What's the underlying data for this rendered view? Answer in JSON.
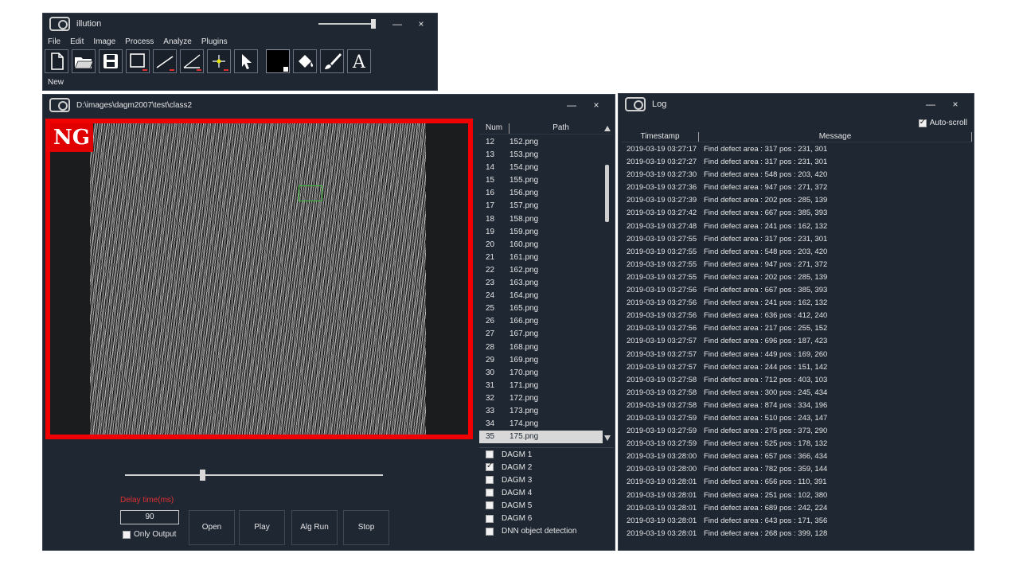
{
  "main_window": {
    "title": "illution",
    "menu": [
      "File",
      "Edit",
      "Image",
      "Process",
      "Analyze",
      "Plugins"
    ],
    "tools": [
      "new-file-icon",
      "open-folder-icon",
      "save-icon",
      "rectangle-tool-icon",
      "line-tool-icon",
      "angle-tool-icon",
      "point-tool-icon",
      "pointer-icon",
      "color-swatch-icon",
      "fill-bucket-icon",
      "brush-icon",
      "text-tool-icon"
    ],
    "status": "New",
    "minimize": "—",
    "close": "×"
  },
  "image_window": {
    "title": "D:\\images\\dagm2007\\test\\class2",
    "badge": "NG",
    "minimize": "—",
    "close": "×",
    "file_list": {
      "headers": [
        "Num",
        "Path"
      ],
      "rows": [
        [
          "12",
          "152.png"
        ],
        [
          "13",
          "153.png"
        ],
        [
          "14",
          "154.png"
        ],
        [
          "15",
          "155.png"
        ],
        [
          "16",
          "156.png"
        ],
        [
          "17",
          "157.png"
        ],
        [
          "18",
          "158.png"
        ],
        [
          "19",
          "159.png"
        ],
        [
          "20",
          "160.png"
        ],
        [
          "21",
          "161.png"
        ],
        [
          "22",
          "162.png"
        ],
        [
          "23",
          "163.png"
        ],
        [
          "24",
          "164.png"
        ],
        [
          "25",
          "165.png"
        ],
        [
          "26",
          "166.png"
        ],
        [
          "27",
          "167.png"
        ],
        [
          "28",
          "168.png"
        ],
        [
          "29",
          "169.png"
        ],
        [
          "30",
          "170.png"
        ],
        [
          "31",
          "171.png"
        ],
        [
          "32",
          "172.png"
        ],
        [
          "33",
          "173.png"
        ],
        [
          "34",
          "174.png"
        ],
        [
          "35",
          "175.png"
        ]
      ],
      "selected_index": 23
    },
    "delay_label": "Delay time(ms)",
    "delay_value": "90",
    "only_output_label": "Only Output",
    "only_output_checked": false,
    "buttons": {
      "open": "Open",
      "play": "Play",
      "alg_run": "Alg Run",
      "stop": "Stop"
    },
    "detectors": [
      {
        "label": "DAGM 1",
        "checked": false
      },
      {
        "label": "DAGM 2",
        "checked": true
      },
      {
        "label": "DAGM 3",
        "checked": false
      },
      {
        "label": "DAGM 4",
        "checked": false
      },
      {
        "label": "DAGM 5",
        "checked": false
      },
      {
        "label": "DAGM 6",
        "checked": false
      },
      {
        "label": "DNN object detection",
        "checked": false
      }
    ],
    "playback_position": 0.29
  },
  "log_window": {
    "title": "Log",
    "autoscroll_label": "Auto-scroll",
    "autoscroll_checked": true,
    "minimize": "—",
    "close": "×",
    "headers": [
      "Timestamp",
      "Message"
    ],
    "rows": [
      [
        "2019-03-19 03:27:17",
        "Find defect area : 317 pos : 231, 301"
      ],
      [
        "2019-03-19 03:27:27",
        "Find defect area : 317 pos : 231, 301"
      ],
      [
        "2019-03-19 03:27:30",
        "Find defect area : 548 pos : 203, 420"
      ],
      [
        "2019-03-19 03:27:36",
        "Find defect area : 947 pos : 271, 372"
      ],
      [
        "2019-03-19 03:27:39",
        "Find defect area : 202 pos : 285, 139"
      ],
      [
        "2019-03-19 03:27:42",
        "Find defect area : 667 pos : 385, 393"
      ],
      [
        "2019-03-19 03:27:48",
        "Find defect area : 241 pos : 162, 132"
      ],
      [
        "2019-03-19 03:27:55",
        "Find defect area : 317 pos : 231, 301"
      ],
      [
        "2019-03-19 03:27:55",
        "Find defect area : 548 pos : 203, 420"
      ],
      [
        "2019-03-19 03:27:55",
        "Find defect area : 947 pos : 271, 372"
      ],
      [
        "2019-03-19 03:27:55",
        "Find defect area : 202 pos : 285, 139"
      ],
      [
        "2019-03-19 03:27:56",
        "Find defect area : 667 pos : 385, 393"
      ],
      [
        "2019-03-19 03:27:56",
        "Find defect area : 241 pos : 162, 132"
      ],
      [
        "2019-03-19 03:27:56",
        "Find defect area : 636 pos : 412, 240"
      ],
      [
        "2019-03-19 03:27:56",
        "Find defect area : 217 pos : 255, 152"
      ],
      [
        "2019-03-19 03:27:57",
        "Find defect area : 696 pos : 187, 423"
      ],
      [
        "2019-03-19 03:27:57",
        "Find defect area : 449 pos : 169, 260"
      ],
      [
        "2019-03-19 03:27:57",
        "Find defect area : 244 pos : 151, 142"
      ],
      [
        "2019-03-19 03:27:58",
        "Find defect area : 712 pos : 403, 103"
      ],
      [
        "2019-03-19 03:27:58",
        "Find defect area : 300 pos : 245, 434"
      ],
      [
        "2019-03-19 03:27:58",
        "Find defect area : 874 pos : 334, 196"
      ],
      [
        "2019-03-19 03:27:59",
        "Find defect area : 510 pos : 243, 147"
      ],
      [
        "2019-03-19 03:27:59",
        "Find defect area : 275 pos : 373, 290"
      ],
      [
        "2019-03-19 03:27:59",
        "Find defect area : 525 pos : 178, 132"
      ],
      [
        "2019-03-19 03:28:00",
        "Find defect area : 657 pos : 366, 434"
      ],
      [
        "2019-03-19 03:28:00",
        "Find defect area : 782 pos : 359, 144"
      ],
      [
        "2019-03-19 03:28:01",
        "Find defect area : 656 pos : 110, 391"
      ],
      [
        "2019-03-19 03:28:01",
        "Find defect area : 251 pos : 102, 380"
      ],
      [
        "2019-03-19 03:28:01",
        "Find defect area : 689 pos : 242, 224"
      ],
      [
        "2019-03-19 03:28:01",
        "Find defect area : 643 pos : 171, 356"
      ],
      [
        "2019-03-19 03:28:01",
        "Find defect area : 268 pos : 399, 128"
      ]
    ]
  },
  "colors": {
    "window_bg": "#1f2733",
    "ng_red": "#e00000",
    "delay_label_red": "#e03030",
    "defect_box_green": "#35c035"
  }
}
